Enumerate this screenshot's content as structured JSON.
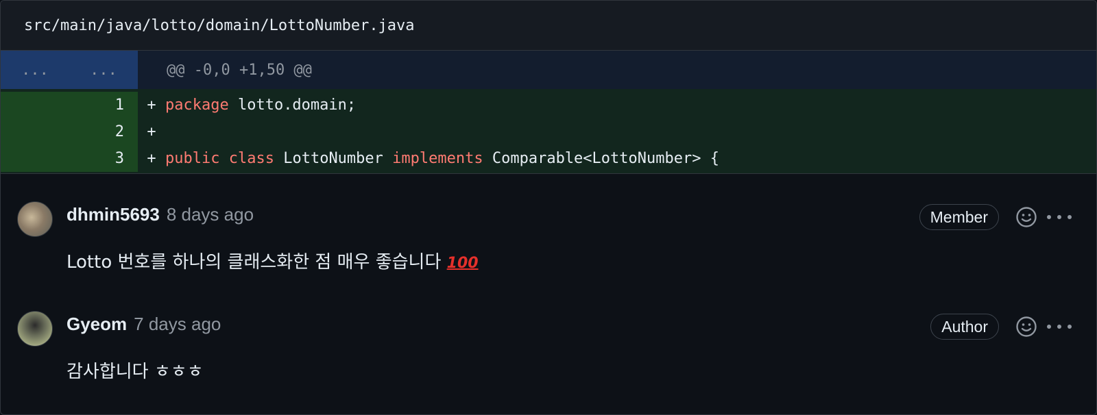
{
  "file": {
    "path": "src/main/java/lotto/domain/LottoNumber.java"
  },
  "diff": {
    "hunk": {
      "old_ln": "...",
      "new_ln": "...",
      "header": "@@ -0,0 +1,50 @@"
    },
    "lines": [
      {
        "ln": "1",
        "marker": "+",
        "kw1": "package",
        "rest1": " lotto.domain;"
      },
      {
        "ln": "2",
        "marker": "+"
      },
      {
        "ln": "3",
        "marker": "+",
        "kw1": "public",
        "sp1": " ",
        "kw2": "class",
        "mid": " LottoNumber ",
        "kw3": "implements",
        "rest": " Comparable<LottoNumber> {"
      }
    ]
  },
  "comments": [
    {
      "user": "dhmin5693",
      "time": "8 days ago",
      "badge": "Member",
      "text": "Lotto 번호를 하나의 클래스화한 점 매우 좋습니다",
      "emoji": "100"
    },
    {
      "user": "Gyeom",
      "time": "7 days ago",
      "badge": "Author",
      "text": "감사합니다 ㅎㅎㅎ"
    }
  ],
  "colors": {
    "background": "#0d1117",
    "addition_bg": "#12261e",
    "hunk_bg": "#131d2e",
    "keyword": "#ff7b72",
    "muted": "#9198a1"
  },
  "icons": [
    "smiley-icon",
    "kebab-horizontal-icon"
  ]
}
